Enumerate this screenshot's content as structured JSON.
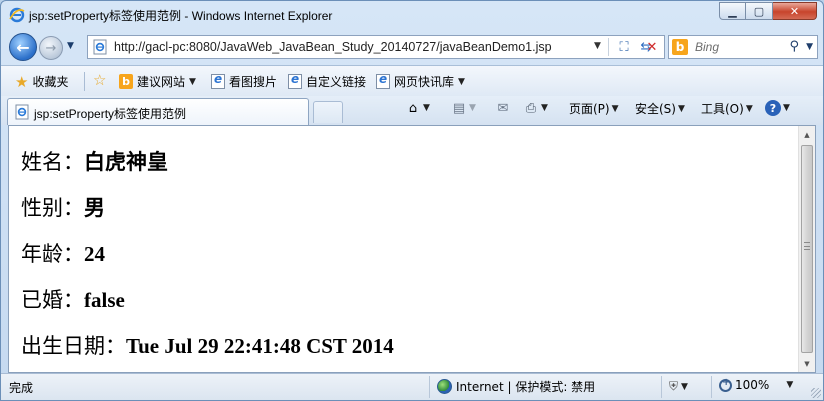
{
  "window": {
    "title": "jsp:setProperty标签使用范例 - Windows Internet Explorer",
    "minimize_icon": "minimize-icon",
    "maximize_icon": "maximize-icon",
    "close_icon": "close-icon"
  },
  "address_bar": {
    "url": "http://gacl-pc:8080/JavaWeb_JavaBean_Study_20140727/javaBeanDemo1.jsp",
    "icons": [
      "ie-page-icon",
      "compatibility-view-icon",
      "refresh-icon",
      "stop-icon"
    ]
  },
  "search": {
    "placeholder": "Bing",
    "engine_icon": "bing-icon",
    "go_icon": "search-icon"
  },
  "favorites_bar": {
    "favorites_label": "收藏夹",
    "items": [
      {
        "label": "建议网站",
        "icon": "bing-icon",
        "has_dropdown": true
      },
      {
        "label": "看图搜片",
        "icon": "ie-page-icon",
        "has_dropdown": false
      },
      {
        "label": "自定义链接",
        "icon": "ie-page-icon",
        "has_dropdown": false
      },
      {
        "label": "网页快讯库",
        "icon": "ie-page-icon",
        "has_dropdown": true
      }
    ]
  },
  "tabs": [
    {
      "label": "jsp:setProperty标签使用范例",
      "icon": "ie-page-icon",
      "active": true
    }
  ],
  "command_bar": {
    "page_label": "页面(P)",
    "safety_label": "安全(S)",
    "tools_label": "工具(O)",
    "icons": [
      "home-icon",
      "rss-feed-icon",
      "read-mail-icon",
      "print-icon",
      "help-icon"
    ]
  },
  "content": {
    "lines": [
      {
        "label": "姓名：",
        "value": "白虎神皇"
      },
      {
        "label": "性别：",
        "value": "男"
      },
      {
        "label": "年龄：",
        "value": "24"
      },
      {
        "label": "已婚：",
        "value": "false"
      },
      {
        "label": "出生日期：",
        "value": "Tue Jul 29 22:41:48 CST 2014"
      }
    ]
  },
  "status_bar": {
    "status_text": "完成",
    "zone_text": "Internet | 保护模式: 禁用",
    "zoom_text": "100%"
  }
}
